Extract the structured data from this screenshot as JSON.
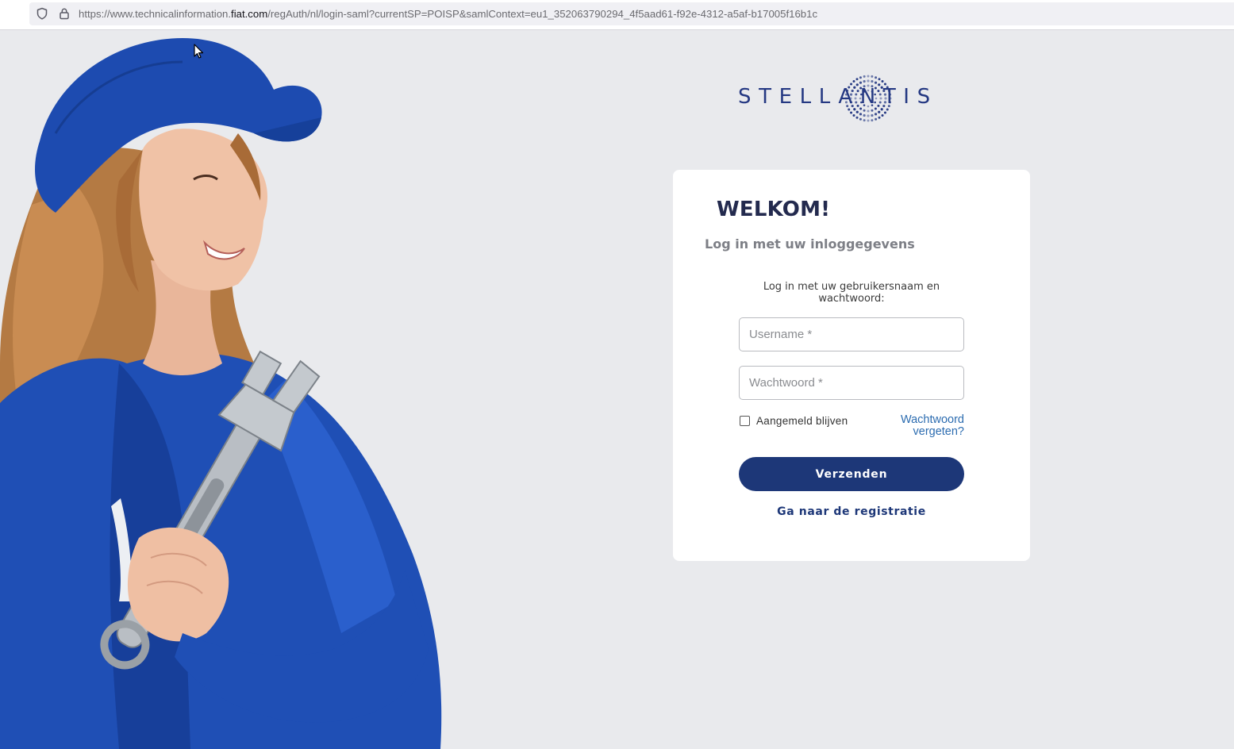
{
  "browser": {
    "url_prefix": "https://www.technicalinformation.",
    "url_domain": "fiat.com",
    "url_suffix": "/regAuth/nl/login-saml?currentSP=POISP&samlContext=eu1_352063790294_4f5aad61-f92e-4312-a5af-b17005f16b1c",
    "icons": [
      "shield-icon",
      "lock-icon"
    ]
  },
  "brand": {
    "logo_text": "STELLANTIS",
    "color": "#243882"
  },
  "login": {
    "welcome": "WELKOM!",
    "subtitle": "Log in met uw inloggegevens",
    "instruction": "Log in met uw gebruikersnaam en wachtwoord:",
    "username": {
      "value": "",
      "placeholder": "Username *"
    },
    "password": {
      "value": "",
      "placeholder": "Wachtwoord *"
    },
    "remember_label": "Aangemeld blijven",
    "remember_checked": false,
    "forgot_link": "Wachtwoord vergeten?",
    "submit_label": "Verzenden",
    "register_link": "Ga naar de registratie"
  },
  "colors": {
    "background": "#e9eaed",
    "primary_button": "#1d3778",
    "link": "#2c6cb0",
    "heading": "#232a4e"
  }
}
